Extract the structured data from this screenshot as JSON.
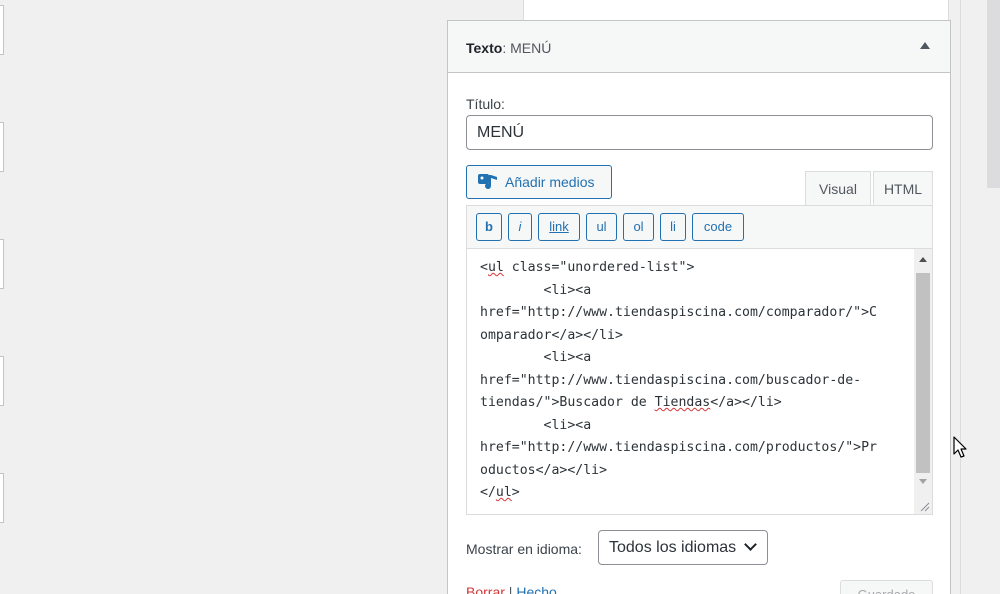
{
  "widget": {
    "title_prefix": "Texto",
    "title_suffix": ": MENÚ",
    "title_label": "Título:",
    "title_value": "MENÚ",
    "add_media_label": "Añadir medios",
    "tabs": {
      "visual": "Visual",
      "html": "HTML"
    },
    "quicktags": [
      "b",
      "i",
      "link",
      "ul",
      "ol",
      "li",
      "code"
    ],
    "code_lines": [
      [
        "<",
        {
          "sq": "ul"
        },
        " class=\"unordered-list\">"
      ],
      [
        "        <li><a"
      ],
      [
        "href=\"http://www.tiendaspiscina.com/comparador/\">C"
      ],
      [
        "omparador</a></li>"
      ],
      [
        "        <li><a"
      ],
      [
        "href=\"http://www.tiendaspiscina.com/buscador-de-"
      ],
      [
        "tiendas/\">Buscador de ",
        {
          "sq": "Tiendas"
        },
        "</a></li>"
      ],
      [
        "        <li><a"
      ],
      [
        "href=\"http://www.tiendaspiscina.com/productos/\">Pr"
      ],
      [
        "oductos</a></li>"
      ],
      [
        "</",
        {
          "sq": "ul"
        },
        ">"
      ]
    ],
    "language_label": "Mostrar en idioma:",
    "language_value": "Todos los idiomas",
    "delete_label": "Borrar",
    "separator": "|",
    "done_label": "Hecho",
    "save_label": "Guardado"
  },
  "colors": {
    "accent": "#2271b1",
    "danger": "#d63638"
  }
}
